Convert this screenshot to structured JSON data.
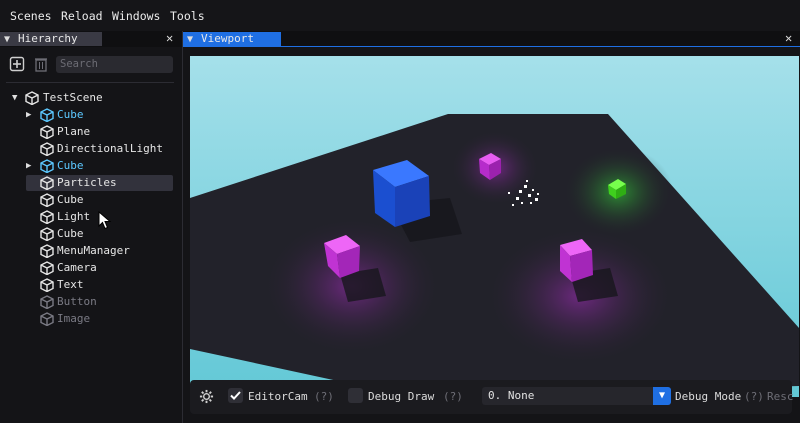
{
  "menubar": {
    "items": [
      "Scenes",
      "Reload",
      "Windows",
      "Tools"
    ]
  },
  "hierarchy": {
    "tab_label": "Hierarchy",
    "search_placeholder": "Search",
    "root": "TestScene",
    "items": [
      {
        "label": "Cube",
        "color": "#5cc8ff",
        "expandable": true
      },
      {
        "label": "Plane",
        "color": "#e6e6e6",
        "expandable": false
      },
      {
        "label": "DirectionalLight",
        "color": "#e6e6e6",
        "expandable": false
      },
      {
        "label": "Cube",
        "color": "#5cc8ff",
        "expandable": true
      },
      {
        "label": "Particles",
        "color": "#e6e6e6",
        "expandable": false,
        "highlighted": true
      },
      {
        "label": "Cube",
        "color": "#e6e6e6",
        "expandable": false
      },
      {
        "label": "Light",
        "color": "#e6e6e6",
        "expandable": false
      },
      {
        "label": "Cube",
        "color": "#e6e6e6",
        "expandable": false
      },
      {
        "label": "MenuManager",
        "color": "#e6e6e6",
        "expandable": false
      },
      {
        "label": "Camera",
        "color": "#e6e6e6",
        "expandable": false
      },
      {
        "label": "Text",
        "color": "#e6e6e6",
        "expandable": false
      },
      {
        "label": "Button",
        "color": "#7a7a84",
        "expandable": false
      },
      {
        "label": "Image",
        "color": "#7a7a84",
        "expandable": false
      }
    ]
  },
  "viewport": {
    "tab_label": "Viewport",
    "sky_color": "#7fd3de",
    "floor_color": "#22222a"
  },
  "bottombar": {
    "editor_cam_label": "EditorCam",
    "editor_cam_checked": true,
    "help": "(?)",
    "debug_draw_label": "Debug Draw",
    "debug_draw_checked": false,
    "dropdown_value": "0. None",
    "debug_mode_label": "Debug Mode",
    "trailing_label": "Resc"
  },
  "colors": {
    "accent": "#1f6fe3",
    "selected_item": "#5cc8ff"
  }
}
